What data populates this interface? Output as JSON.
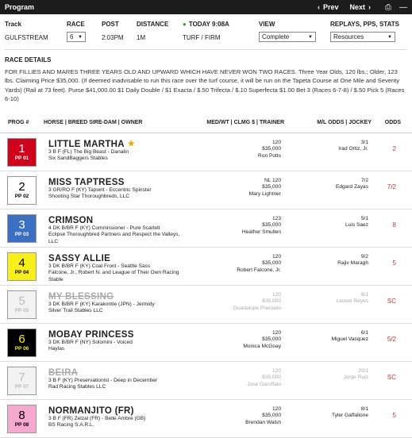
{
  "topbar": {
    "title": "Program",
    "prev": "Prev",
    "next": "Next"
  },
  "header": {
    "track_label": "Track",
    "track_value": "GULFSTREAM",
    "race_label": "RACE",
    "race_value": "6",
    "post_label": "POST",
    "post_value": "2:03PM",
    "distance_label": "DISTANCE",
    "distance_value": "1M",
    "today_label": "TODAY 9:08A",
    "surface_value": "TURF / FIRM",
    "view_label": "VIEW",
    "view_value": "Complete",
    "replays_label": "REPLAYS, PPS, STATS",
    "replays_value": "Resources"
  },
  "race_details": {
    "heading": "RACE DETAILS",
    "text": "FOR FILLIES AND MARES THREE YEARS OLD AND UPWARD WHICH HAVE NEVER WON TWO RACES. Three Year Olds, 120 lbs.; Older, 123 lbs. Claiming Price $35,000. (If deemed inadvisable to run this race over the turf course, it will be run on the Tapeta Course at One Mile and Seventy Yards) (Rail at 73 feet). Purse $41,000.00 $1 Daily Double / $1 Exacta / $.50 Trifecta / $.10 Superfecta $1.00 Bet 3 (Races 6-7-8) / $.50 Pick 5 (Races 6-10)"
  },
  "columns": {
    "prog": "PROG #",
    "horse": "HORSE | BREED SIRE-DAM | OWNER",
    "med": "MED/WT | CLMG $ | TRAINER",
    "ml": "M/L ODDS | JOCKEY",
    "odds": "ODDS"
  },
  "entries": [
    {
      "num": "1",
      "pp": "PP 01",
      "name": "LITTLE MARTHA",
      "breed": "3 B F (FL) The Big Beast - Danalin",
      "owner": "Six SandBaggers Stables",
      "med": "120",
      "clmg": "$35,000",
      "trainer": "Ron Potts",
      "ml": "3/1",
      "jockey": "Irad Ortiz, Jr.",
      "odds": "2",
      "bg": "#d0021b",
      "fg": "#ffffff"
    },
    {
      "num": "2",
      "pp": "PP 02",
      "name": "MISS TAPTRESS",
      "breed": "3 GR/RO F (KY) Tapwrit - Eccentric Spinster",
      "owner": "Shooting Star Thoroughbreds, LLC",
      "med": "NL 120",
      "clmg": "$35,000",
      "trainer": "Mary Lightner",
      "ml": "7/2",
      "jockey": "Edgard Zayas",
      "odds": "7/2",
      "bg": "#ffffff",
      "fg": "#000000"
    },
    {
      "num": "3",
      "pp": "PP 03",
      "name": "CRIMSON",
      "breed": "4 DK B/BR F (KY) Commissioner - Pure Scarlett",
      "owner": "Eclipse Thoroughbred Partners and Respect the Valleys, LLC",
      "med": "123",
      "clmg": "$35,000",
      "trainer": "Heather Smullen",
      "ml": "5/1",
      "jockey": "Luis Saez",
      "odds": "8",
      "bg": "#3b6fc2",
      "fg": "#ffffff"
    },
    {
      "num": "4",
      "pp": "PP 04",
      "name": "SASSY ALLIE",
      "breed": "3 DK B/BR F (KY) Coal Front - Seattle Sass",
      "owner": "Falcone, Jr., Robert N. and League of Their Own Racing Stable",
      "med": "120",
      "clmg": "$35,000",
      "trainer": "Robert Falcone, Jr.",
      "ml": "9/2",
      "jockey": "Rajiv Maragh",
      "odds": "5",
      "bg": "#f7ee1c",
      "fg": "#000000"
    },
    {
      "num": "5",
      "pp": "PP 05",
      "name": "MY BLESSING",
      "breed": "3 DK B/BR F (KY) Karakontie (JPN) - Jermidy",
      "owner": "Silver Trail Stables LLC",
      "med": "120",
      "clmg": "$35,000",
      "trainer": "Guadalupe Preciado",
      "ml": "6/1",
      "jockey": "Leonel Reyes",
      "odds": "SC",
      "bg": "#f2f2f2",
      "fg": "#bbbbbb",
      "scratched": true
    },
    {
      "num": "6",
      "pp": "PP 06",
      "name": "MOBAY PRINCESS",
      "breed": "3 DK B/BR F (NY) Solomini - Voiced",
      "owner": "Haylas",
      "med": "120",
      "clmg": "$35,000",
      "trainer": "Monica McGoay",
      "ml": "6/1",
      "jockey": "Miguel Vasquez",
      "odds": "5/2",
      "bg": "#000000",
      "fg": "#f7ee1c"
    },
    {
      "num": "7",
      "pp": "PP 07",
      "name": "BEIRA",
      "breed": "3 B F (KY) Preservationist - Deep in December",
      "owner": "Rad Racing Stables LLC",
      "med": "120",
      "clmg": "$35,000",
      "trainer": "Jose Garoffalo",
      "ml": "20/1",
      "jockey": "Jorge Ruiz",
      "odds": "SC",
      "bg": "#f2f2f2",
      "fg": "#bbbbbb",
      "scratched": true
    },
    {
      "num": "8",
      "pp": "PP 08",
      "name": "NORMANJITO (FR)",
      "breed": "3 B F (FR) Zelzal (FR) - Belle Ambre (GB)",
      "owner": "BS Racing S.A.R.L.",
      "med": "120",
      "clmg": "$35,000",
      "trainer": "Brendan Walsh",
      "ml": "8/1",
      "jockey": "Tyler Gaffalione",
      "odds": "5",
      "bg": "#f7a8cf",
      "fg": "#000000"
    }
  ]
}
